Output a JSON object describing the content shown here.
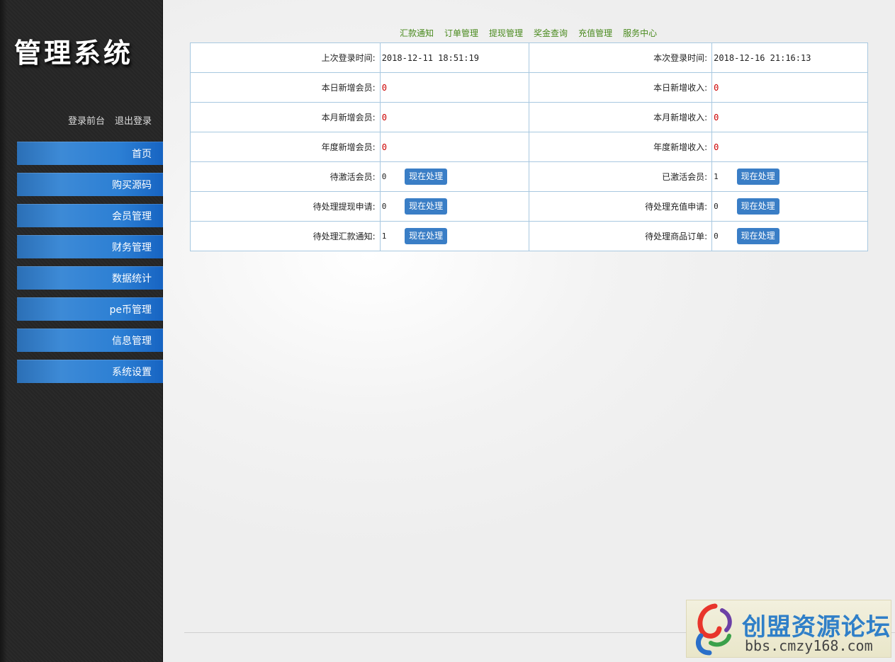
{
  "sidebar": {
    "logo": "管理系统",
    "links": [
      "登录前台",
      "退出登录"
    ],
    "nav": [
      "首页",
      "购买源码",
      "会员管理",
      "财务管理",
      "数据统计",
      "pe币管理",
      "信息管理",
      "系统设置"
    ]
  },
  "topnav": [
    "汇款通知",
    "订单管理",
    "提现管理",
    "奖金查询",
    "充值管理",
    "服务中心"
  ],
  "stats": {
    "last_login_label": "上次登录时间:",
    "last_login_value": "2018-12-11 18:51:19",
    "this_login_label": "本次登录时间:",
    "this_login_value": "2018-12-16 21:16:13",
    "day_members_label": "本日新增会员:",
    "day_members_value": "0",
    "day_income_label": "本日新增收入:",
    "day_income_value": "0",
    "month_members_label": "本月新增会员:",
    "month_members_value": "0",
    "month_income_label": "本月新增收入:",
    "month_income_value": "0",
    "year_members_label": "年度新增会员:",
    "year_members_value": "0",
    "year_income_label": "年度新增收入:",
    "year_income_value": "0",
    "pending_activation_label": "待激活会员:",
    "pending_activation_value": "0",
    "activated_label": "已激活会员:",
    "activated_value": "1",
    "pending_withdraw_label": "待处理提现申请:",
    "pending_withdraw_value": "0",
    "pending_recharge_label": "待处理充值申请:",
    "pending_recharge_value": "0",
    "pending_remit_label": "待处理汇款通知:",
    "pending_remit_value": "1",
    "pending_orders_label": "待处理商品订单:",
    "pending_orders_value": "0",
    "process_button": "现在处理"
  },
  "watermark": {
    "title": "创盟资源论坛",
    "url": "bbs.cmzy168.com"
  }
}
